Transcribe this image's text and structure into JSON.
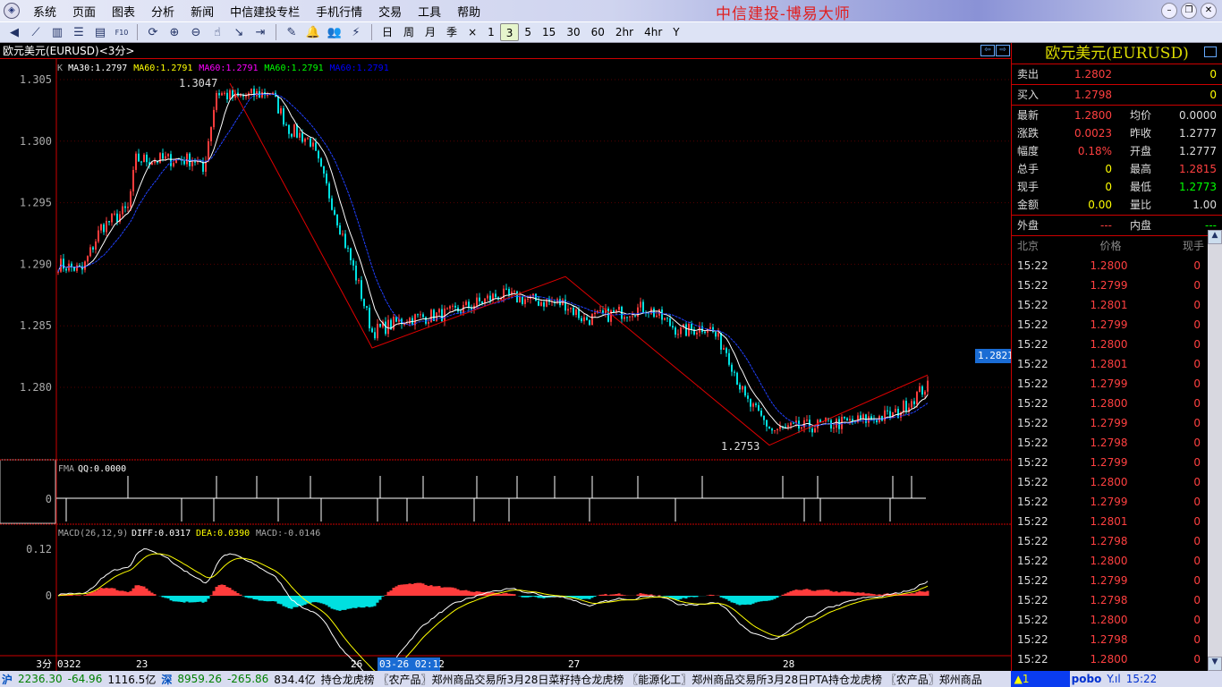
{
  "menu": [
    "系统",
    "页面",
    "图表",
    "分析",
    "新闻",
    "中信建投专栏",
    "手机行情",
    "交易",
    "工具",
    "帮助"
  ],
  "app_title": "中信建投-博易大师",
  "toolbar": {
    "icons": [
      "back-icon",
      "line-chart-icon",
      "kline-icon",
      "list-icon",
      "window-icon",
      "f10-icon",
      "refresh-icon",
      "zoom-in-icon",
      "zoom-out-icon",
      "hand-icon",
      "export-icon",
      "import-icon",
      "draw-icon",
      "alarm-icon",
      "users-icon",
      "lightning-icon"
    ],
    "periods": [
      "日",
      "周",
      "月",
      "季",
      "×",
      "1",
      "3",
      "5",
      "15",
      "30",
      "60",
      "2hr",
      "4hr",
      "Y"
    ],
    "active_period": "3"
  },
  "chart": {
    "title": "欧元美元(EURUSD)<3分>",
    "legend": [
      {
        "text": "K",
        "color": "#aaaaaa"
      },
      {
        "text": "MA30:1.2797",
        "color": "#ffffff"
      },
      {
        "text": "MA60:1.2791",
        "color": "#ffff00"
      },
      {
        "text": "MA60:1.2791",
        "color": "#ff00ff"
      },
      {
        "text": "MA60:1.2791",
        "color": "#00ff00"
      },
      {
        "text": "MA60:1.2791",
        "color": "#0000ff"
      }
    ],
    "high_label": "1.3047",
    "low_label": "1.2753",
    "current_price": "1.2821",
    "fma_label": "FMA",
    "fma_value": "QQ:0.0000",
    "fma_zero": "0",
    "macd_label": "MACD(26,12,9)",
    "diff": "DIFF:0.0317",
    "dea": "DEA:0.0390",
    "macd": "MACD:-0.0146",
    "macd_ticks": [
      "0.12",
      "0"
    ],
    "period_label": "3分",
    "time_labels": [
      "0322",
      "23",
      "26",
      "27",
      "28"
    ],
    "cursor_time": "03-26 02:12"
  },
  "chart_data": {
    "type": "candlestick",
    "title": "欧元美元(EURUSD)",
    "y_ticks": [
      1.305,
      1.3,
      1.295,
      1.29,
      1.285,
      1.28
    ],
    "ylim": [
      1.2747,
      1.3061
    ],
    "bars": 325,
    "waypoints": [
      [
        0,
        1.29
      ],
      [
        9,
        1.2895
      ],
      [
        16,
        1.293
      ],
      [
        26,
        1.2945
      ],
      [
        29,
        1.2985
      ],
      [
        37,
        1.2985
      ],
      [
        51,
        1.2985
      ],
      [
        54,
        1.2975
      ],
      [
        59,
        1.304
      ],
      [
        66,
        1.3035
      ],
      [
        79,
        1.304
      ],
      [
        86,
        1.301
      ],
      [
        94,
        1.3
      ],
      [
        102,
        1.295
      ],
      [
        111,
        1.289
      ],
      [
        117,
        1.2845
      ],
      [
        129,
        1.2855
      ],
      [
        146,
        1.286
      ],
      [
        164,
        1.2875
      ],
      [
        179,
        1.287
      ],
      [
        189,
        1.2868
      ],
      [
        196,
        1.2855
      ],
      [
        219,
        1.2865
      ],
      [
        232,
        1.2845
      ],
      [
        242,
        1.285
      ],
      [
        249,
        1.283
      ],
      [
        256,
        1.279
      ],
      [
        266,
        1.2765
      ],
      [
        279,
        1.2768
      ],
      [
        296,
        1.2772
      ],
      [
        312,
        1.2778
      ],
      [
        323,
        1.28
      ]
    ],
    "zigzag": [
      [
        64,
        1.3047
      ],
      [
        117,
        1.2832
      ],
      [
        189,
        1.289
      ],
      [
        265,
        1.2753
      ],
      [
        324,
        1.281
      ]
    ],
    "fma_up": [
      26,
      59,
      74,
      94,
      120,
      136,
      156,
      171,
      185,
      199,
      216,
      240,
      270,
      283,
      311,
      318
    ],
    "fma_down": [
      3,
      46,
      58,
      82,
      98,
      119,
      130,
      155,
      168,
      198,
      230,
      278,
      284,
      310
    ],
    "time_label_bars": [
      0,
      31,
      111,
      192,
      272
    ]
  },
  "quote": {
    "title": "欧元美元(EURUSD)",
    "sell": {
      "label": "卖出",
      "price": "1.2802",
      "vol": "0"
    },
    "buy": {
      "label": "买入",
      "price": "1.2798",
      "vol": "0"
    },
    "rows": [
      [
        "最新",
        "1.2800",
        "均价",
        "0.0000"
      ],
      [
        "涨跌",
        "0.0023",
        "昨收",
        "1.2777"
      ],
      [
        "幅度",
        "0.18%",
        "开盘",
        "1.2777"
      ],
      [
        "总手",
        "0",
        "最高",
        "1.2815"
      ],
      [
        "现手",
        "0",
        "最低",
        "1.2773"
      ],
      [
        "金额",
        "0.00",
        "量比",
        "1.00"
      ]
    ],
    "outer": [
      "外盘",
      "---",
      "内盘",
      "---"
    ],
    "tick_headers": [
      "北京",
      "价格",
      "现手"
    ],
    "ticks": [
      [
        "15:22",
        "1.2800",
        "0"
      ],
      [
        "15:22",
        "1.2799",
        "0"
      ],
      [
        "15:22",
        "1.2801",
        "0"
      ],
      [
        "15:22",
        "1.2799",
        "0"
      ],
      [
        "15:22",
        "1.2800",
        "0"
      ],
      [
        "15:22",
        "1.2801",
        "0"
      ],
      [
        "15:22",
        "1.2799",
        "0"
      ],
      [
        "15:22",
        "1.2800",
        "0"
      ],
      [
        "15:22",
        "1.2799",
        "0"
      ],
      [
        "15:22",
        "1.2798",
        "0"
      ],
      [
        "15:22",
        "1.2799",
        "0"
      ],
      [
        "15:22",
        "1.2800",
        "0"
      ],
      [
        "15:22",
        "1.2799",
        "0"
      ],
      [
        "15:22",
        "1.2801",
        "0"
      ],
      [
        "15:22",
        "1.2798",
        "0"
      ],
      [
        "15:22",
        "1.2800",
        "0"
      ],
      [
        "15:22",
        "1.2799",
        "0"
      ],
      [
        "15:22",
        "1.2798",
        "0"
      ],
      [
        "15:22",
        "1.2800",
        "0"
      ],
      [
        "15:22",
        "1.2798",
        "0"
      ],
      [
        "15:22",
        "1.2800",
        "0"
      ]
    ]
  },
  "status": {
    "sh_label": "沪",
    "sh_index": "2236.30",
    "sh_change": "-64.96",
    "sh_amount": "1116.5亿",
    "sz_label": "深",
    "sz_index": "8959.26",
    "sz_change": "-265.86",
    "sz_amount": "834.4亿",
    "news": "持仓龙虎榜    〖农产品〗郑州商品交易所3月28日菜籽持仓龙虎榜    〖能源化工〗郑州商品交易所3月28日PTA持仓龙虎榜    〖农产品〗郑州商品",
    "alert": "▲1",
    "brand": "pobo",
    "signal": "Y.ıl",
    "time": "15:22"
  }
}
